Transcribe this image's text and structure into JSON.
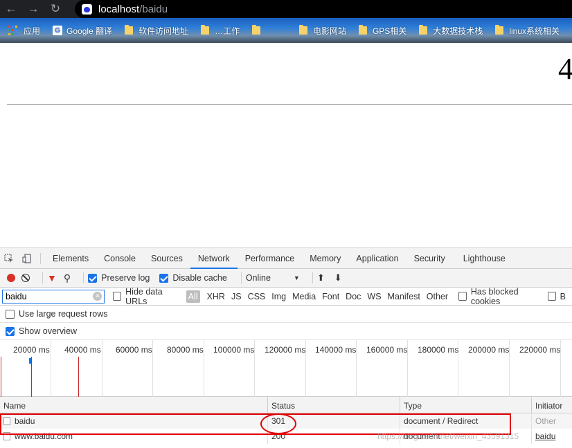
{
  "browser": {
    "url_host": "localhost",
    "url_path": "/baidu",
    "bookmarks": [
      {
        "label": "应用",
        "icon": "apps-icon"
      },
      {
        "label": "Google 翻译",
        "icon": "google-translate-icon"
      },
      {
        "label": "软件访问地址",
        "icon": "folder-icon"
      },
      {
        "label": "…工作",
        "icon": "folder-icon"
      },
      {
        "label": "",
        "icon": "folder-icon"
      },
      {
        "label": "电影网站",
        "icon": "folder-icon"
      },
      {
        "label": "GPS相关",
        "icon": "folder-icon"
      },
      {
        "label": "大数据技术栈",
        "icon": "folder-icon"
      },
      {
        "label": "linux系统相关",
        "icon": "folder-icon"
      }
    ]
  },
  "page": {
    "heading": "4"
  },
  "devtools": {
    "tabs": [
      "Elements",
      "Console",
      "Sources",
      "Network",
      "Performance",
      "Memory",
      "Application",
      "Security",
      "Lighthouse"
    ],
    "active_tab": "Network",
    "toolbar": {
      "preserve_log": "Preserve log",
      "disable_cache": "Disable cache",
      "throttling": "Online"
    },
    "filter": {
      "value": "baidu",
      "hide_data_urls": "Hide data URLs",
      "types": [
        "All",
        "XHR",
        "JS",
        "CSS",
        "Img",
        "Media",
        "Font",
        "Doc",
        "WS",
        "Manifest",
        "Other"
      ],
      "has_blocked_cookies": "Has blocked cookies",
      "blocked_requests": "B"
    },
    "options": {
      "large_rows": "Use large request rows",
      "show_overview": "Show overview"
    },
    "timeline_ticks": [
      "20000 ms",
      "40000 ms",
      "60000 ms",
      "80000 ms",
      "100000 ms",
      "120000 ms",
      "140000 ms",
      "160000 ms",
      "180000 ms",
      "200000 ms",
      "220000 ms"
    ],
    "columns": [
      "Name",
      "Status",
      "Type",
      "Initiator"
    ],
    "rows": [
      {
        "name": "baidu",
        "status": "301",
        "type": "document / Redirect",
        "initiator": "Other"
      },
      {
        "name": "www.baidu.com",
        "status": "200",
        "type": "document",
        "initiator": "baidu"
      }
    ]
  },
  "watermark": "https://blog.csdn.net/weixin_43591315",
  "colors": {
    "accent": "#1a73e8",
    "record": "#d93025",
    "annotation": "#e00000"
  }
}
